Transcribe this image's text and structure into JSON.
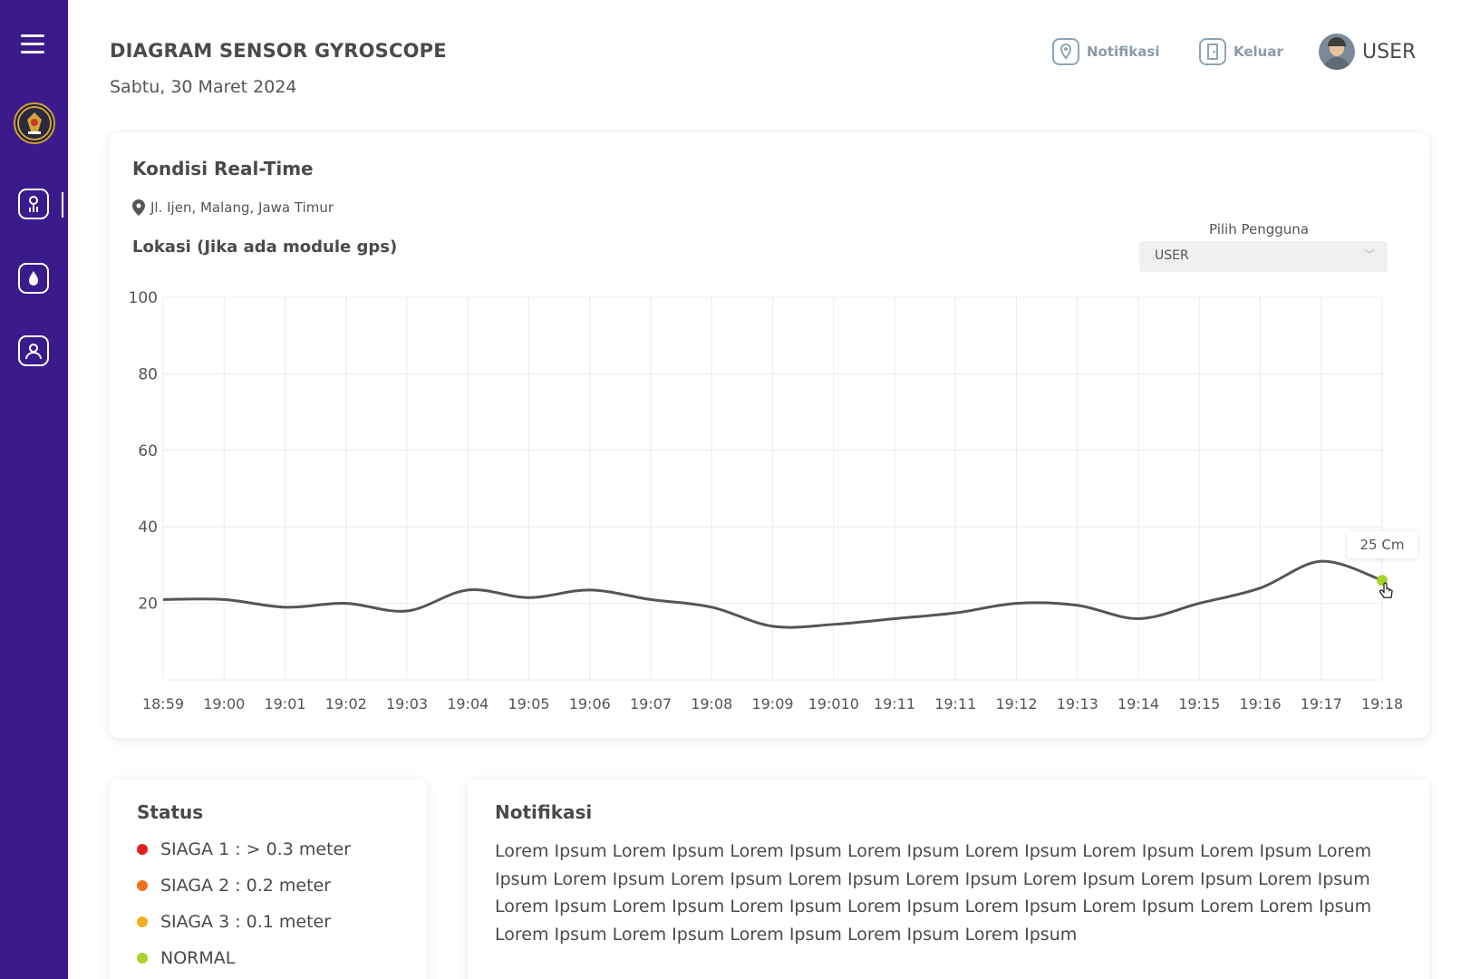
{
  "header": {
    "title": "DIAGRAM SENSOR GYROSCOPE",
    "date": "Sabtu, 30 Maret 2024",
    "notif_label": "Notifikasi",
    "logout_label": "Keluar",
    "user_label": "USER"
  },
  "sidebar": {
    "items": [
      {
        "icon": "hamburger-menu-icon"
      },
      {
        "icon": "university-logo"
      },
      {
        "icon": "sensor-chart-icon",
        "active": true
      },
      {
        "icon": "water-drop-icon"
      },
      {
        "icon": "user-profile-icon"
      }
    ]
  },
  "chart_card": {
    "title": "Kondisi Real-Time",
    "address": "Jl. Ijen, Malang, Jawa Timur",
    "location_label": "Lokasi (Jika ada module gps)",
    "select_label": "Pilih Pengguna",
    "select_value": "USER",
    "tooltip": "25 Cm"
  },
  "chart_data": {
    "type": "line",
    "x": [
      "18:59",
      "19:00",
      "19:01",
      "19:02",
      "19:03",
      "19:04",
      "19:05",
      "19:06",
      "19:07",
      "19:08",
      "19:09",
      "19:010",
      "19:11",
      "19:11",
      "19:12",
      "19:13",
      "19:14",
      "19:15",
      "19:16",
      "19:17",
      "19:18"
    ],
    "y": [
      21,
      21,
      19,
      20,
      18,
      23.5,
      21.5,
      23.5,
      21,
      19,
      14,
      14.5,
      16,
      17.5,
      20,
      19.5,
      16,
      20,
      24,
      31,
      26
    ],
    "ylim": [
      0,
      100
    ],
    "yticks": [
      20,
      40,
      60,
      80,
      100
    ],
    "grid": true,
    "series_color": "#555555",
    "highlight_color": "#a8d42a",
    "title": "",
    "xlabel": "",
    "ylabel": ""
  },
  "status": {
    "title": "Status",
    "items": [
      {
        "label": "SIAGA 1 : > 0.3 meter",
        "color": "#e0201c"
      },
      {
        "label": "SIAGA 2 : 0.2 meter",
        "color": "#f07020"
      },
      {
        "label": "SIAGA 3 : 0.1 meter",
        "color": "#f0b020"
      },
      {
        "label": "NORMAL",
        "color": "#a8d42a"
      }
    ]
  },
  "notifikasi": {
    "title": "Notifikasi",
    "text": "Lorem Ipsum Lorem Ipsum Lorem Ipsum Lorem Ipsum Lorem Ipsum Lorem Ipsum Lorem Ipsum Lorem Ipsum Lorem Ipsum Lorem Ipsum Lorem Ipsum Lorem Ipsum Lorem Ipsum Lorem Ipsum Lorem Ipsum Lorem Ipsum Lorem Ipsum Lorem Ipsum Lorem Ipsum Lorem Ipsum Lorem Ipsum Lorem Lorem Ipsum Lorem Ipsum Lorem Ipsum Lorem Ipsum Lorem Ipsum Lorem Ipsum"
  }
}
